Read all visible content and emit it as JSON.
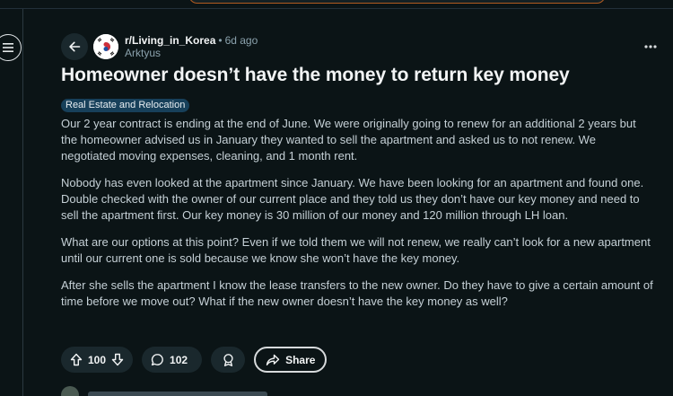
{
  "post": {
    "subreddit": "r/Living_in_Korea",
    "separator": "•",
    "age": "6d ago",
    "author": "Arktyus",
    "title": "Homeowner doesn’t have the money to return key money",
    "flair": "Real Estate and Relocation",
    "body": [
      "Our 2 year contract is ending at the end of June. We were originally going to renew for an additional 2 years but the homeowner advised us in January they wanted to sell the apartment and asked us to not renew. We negotiated moving expenses, cleaning, and 1 month rent.",
      "Nobody has even looked at the apartment since January. We have been looking for an apartment and found one. Double checked with the owner of our current place and they told us they don’t have our key money and need to sell the apartment first. Our key money is 30 million of our money and 120 million through LH loan.",
      "What are our options at this point? Even if we told them we will not renew, we really can’t look for a new apartment until our current one is sold because we know she won’t have the key money.",
      "After she sells the apartment I know the lease transfers to the new owner. Do they have to give a certain amount of time before we move out? What if the new owner doesn’t have the key money as well?"
    ]
  },
  "actions": {
    "votes": "100",
    "comments": "102",
    "share_label": "Share"
  },
  "icons": {
    "menu": "hamburger-icon",
    "back": "arrow-left-icon",
    "avatar": "korea-flag-icon",
    "more": "ellipsis-icon",
    "upvote": "arrow-up-icon",
    "downvote": "arrow-down-icon",
    "comment": "speech-bubble-icon",
    "award": "award-icon",
    "share": "share-arrow-icon"
  },
  "colors": {
    "background": "#0b1416",
    "flair_bg": "#17405a",
    "pill_bg": "#1a282d",
    "title": "#f2f4f5"
  }
}
